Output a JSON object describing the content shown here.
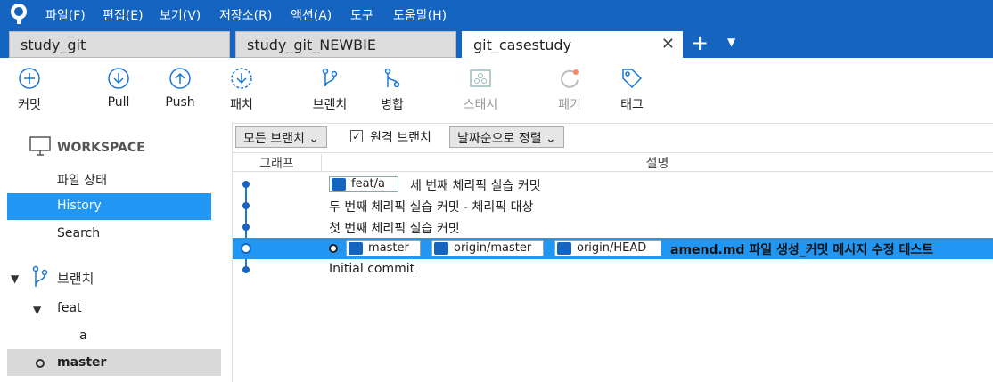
{
  "menu": [
    "파일(F)",
    "편집(E)",
    "보기(V)",
    "저장소(R)",
    "액션(A)",
    "도구",
    "도움말(H)"
  ],
  "tabs": [
    {
      "label": "study_git"
    },
    {
      "label": "study_git_NEWBIE"
    },
    {
      "label": "git_casestudy"
    }
  ],
  "toolbar": {
    "commit": "커밋",
    "pull": "Pull",
    "push": "Push",
    "patch": "패치",
    "branch": "브랜치",
    "merge": "병합",
    "stash": "스태시",
    "discard": "폐기",
    "tag": "태그"
  },
  "sidebar": {
    "workspace": "WORKSPACE",
    "file_status": "파일 상태",
    "history": "History",
    "search": "Search",
    "branches": "브랜치",
    "feat": "feat",
    "a": "a",
    "master": "master"
  },
  "filters": {
    "all_branches": "모든 브랜치 ⌄",
    "remote_branches": "원격 브랜치",
    "sort": "날짜순으로 정렬 ⌄"
  },
  "columns": {
    "graph": "그래프",
    "description": "설명"
  },
  "commits": {
    "c1": {
      "tag": "feat/a",
      "message": "세 번째 체리픽 실습 커밋"
    },
    "c2": {
      "message": "두 번째 체리픽 실습 커밋 - 체리픽 대상"
    },
    "c3": {
      "message": "첫 번째 체리픽 실습 커밋"
    },
    "c4": {
      "tag1": "master",
      "tag2": "origin/master",
      "tag3": "origin/HEAD",
      "message": "amend.md 파일 생성_커밋 메시지 수정 테스트"
    },
    "c5": {
      "message": "Initial commit"
    }
  },
  "colors": {
    "brand": "#1565c0",
    "selected": "#2196f3"
  }
}
